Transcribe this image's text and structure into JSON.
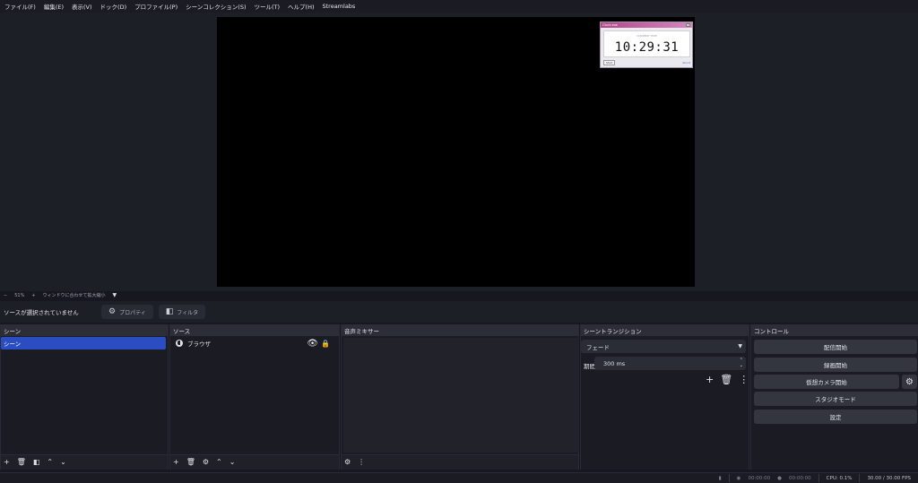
{
  "menu": [
    "ファイル(F)",
    "編集(E)",
    "表示(V)",
    "ドック(D)",
    "プロファイル(P)",
    "シーンコレクション(S)",
    "ツール(T)",
    "ヘルプ(H)",
    "Streamlabs"
  ],
  "clock": {
    "title": "Clock.exe",
    "subtitle": "CURRENT TIME",
    "time": "10:29:31",
    "start": "Start",
    "link": "About"
  },
  "zoombar": {
    "minus": "−",
    "zoom": "51%",
    "plus": "+",
    "fit": "ウィンドウに合わせて拡大縮小",
    "caret": "▼"
  },
  "propbar": {
    "no_source": "ソースが選択されていません",
    "properties": "プロパティ",
    "filters": "フィルタ"
  },
  "docks": {
    "scenes": {
      "title": "シーン",
      "items": [
        "シーン"
      ]
    },
    "sources": {
      "title": "ソース",
      "items": [
        {
          "name": "ブラウザ"
        }
      ]
    },
    "mixer": {
      "title": "音声ミキサー"
    },
    "transitions": {
      "title": "シーントランジション",
      "type": "フェード",
      "duration_label": "期間",
      "duration": "300 ms"
    },
    "controls": {
      "title": "コントロール",
      "buttons": [
        "配信開始",
        "録画開始",
        "仮想カメラ開始",
        "スタジオモード",
        "設定"
      ]
    }
  },
  "status": {
    "stream_time": "00:00:00",
    "rec_time": "00:00:00",
    "cpu": "CPU: 0.1%",
    "fps": "30.00 / 30.00 FPS"
  },
  "icons": [
    "plus-icon",
    "trash-icon",
    "filter-icon",
    "chevron-up-icon",
    "chevron-down-icon",
    "gear-icon",
    "eye-icon",
    "lock-icon",
    "globe-icon",
    "more-icon",
    "signal-icon",
    "record-icon",
    "stream-icon"
  ],
  "colors": {
    "selected": "#2a4dc2",
    "panel": "#1b1c23",
    "header": "#2c2e37",
    "button": "#34363f"
  }
}
